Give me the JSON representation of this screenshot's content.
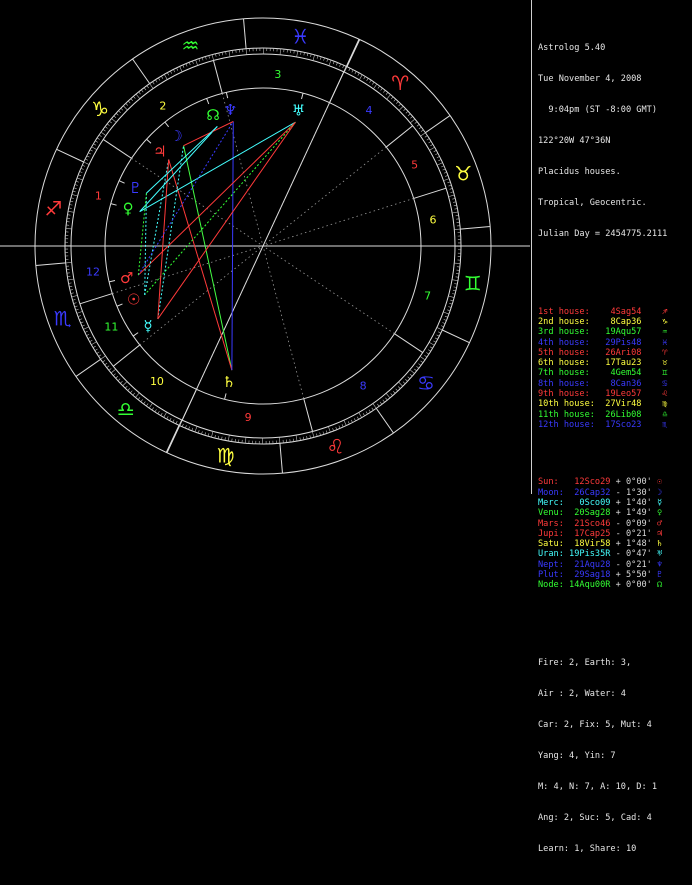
{
  "header": [
    "Astrolog 5.40",
    "Tue November 4, 2008",
    "  9:04pm (ST -8:00 GMT)",
    "122°20W 47°36N",
    "Placidus houses.",
    "Tropical, Geocentric.",
    "Julian Day = 2454775.2111"
  ],
  "houses": [
    {
      "label": "1st house:",
      "value": "4Sag54",
      "glyph": "♐",
      "color": "#ff3a3a"
    },
    {
      "label": "2nd house:",
      "value": "8Cap36",
      "glyph": "♑",
      "color": "#ffff40"
    },
    {
      "label": "3rd house:",
      "value": "19Aqu57",
      "glyph": "♒",
      "color": "#33ff33"
    },
    {
      "label": "4th house:",
      "value": "29Pis48",
      "glyph": "♓",
      "color": "#3a3aff"
    },
    {
      "label": "5th house:",
      "value": "26Ari08",
      "glyph": "♈",
      "color": "#ff3a3a"
    },
    {
      "label": "6th house:",
      "value": "17Tau23",
      "glyph": "♉",
      "color": "#ffff40"
    },
    {
      "label": "7th house:",
      "value": "4Gem54",
      "glyph": "♊",
      "color": "#33ff33"
    },
    {
      "label": "8th house:",
      "value": "8Can36",
      "glyph": "♋",
      "color": "#3a3aff"
    },
    {
      "label": "9th house:",
      "value": "19Leo57",
      "glyph": "♌",
      "color": "#ff3a3a"
    },
    {
      "label": "10th house:",
      "value": "27Vir48",
      "glyph": "♍",
      "color": "#ffff40"
    },
    {
      "label": "11th house:",
      "value": "26Lib08",
      "glyph": "♎",
      "color": "#33ff33"
    },
    {
      "label": "12th house:",
      "value": "17Sco23",
      "glyph": "♏",
      "color": "#3a3aff"
    }
  ],
  "planets": [
    {
      "name": "Sun:",
      "pos": "12Sco29",
      "speed": "+ 0°00'",
      "glyph": "☉",
      "color": "#ff3a3a"
    },
    {
      "name": "Moon:",
      "pos": "26Cap32",
      "speed": "- 1°30'",
      "glyph": "☽",
      "color": "#3a3aff"
    },
    {
      "name": "Merc:",
      "pos": "0Sco09",
      "speed": "+ 1°40'",
      "glyph": "☿",
      "color": "#44ffff"
    },
    {
      "name": "Venu:",
      "pos": "20Sag28",
      "speed": "+ 1°49'",
      "glyph": "♀",
      "color": "#33ff33"
    },
    {
      "name": "Mars:",
      "pos": "21Sco46",
      "speed": "- 0°09'",
      "glyph": "♂",
      "color": "#ff3a3a"
    },
    {
      "name": "Jupi:",
      "pos": "17Cap25",
      "speed": "- 0°21'",
      "glyph": "♃",
      "color": "#ff3a3a"
    },
    {
      "name": "Satu:",
      "pos": "18Vir58",
      "speed": "+ 1°48'",
      "glyph": "♄",
      "color": "#ffff40"
    },
    {
      "name": "Uran:",
      "pos": "19Pis35R",
      "speed": "- 0°47'",
      "glyph": "♅",
      "color": "#44ffff"
    },
    {
      "name": "Nept:",
      "pos": "21Aqu28",
      "speed": "- 0°21'",
      "glyph": "♆",
      "color": "#3a3aff"
    },
    {
      "name": "Plut:",
      "pos": "29Sag18",
      "speed": "+ 5°50'",
      "glyph": "♇",
      "color": "#3a3aff"
    },
    {
      "name": "Node:",
      "pos": "14Aqu00R",
      "speed": "+ 0°00'",
      "glyph": "☊",
      "color": "#33ff33"
    }
  ],
  "summary": [
    "Fire: 2, Earth: 3,",
    "Air : 2, Water: 4",
    "Car: 2, Fix: 5, Mut: 4",
    "Yang: 4, Yin: 7",
    "M: 4, N: 7, A: 10, D: 1",
    "Ang: 2, Suc: 5, Cad: 4",
    "Learn: 1, Share: 10"
  ],
  "wheel": {
    "signs": [
      {
        "name": "Aries",
        "glyph": "♈",
        "color": "#ff3a3a"
      },
      {
        "name": "Taurus",
        "glyph": "♉",
        "color": "#ffff40"
      },
      {
        "name": "Gemini",
        "glyph": "♊",
        "color": "#33ff33"
      },
      {
        "name": "Cancer",
        "glyph": "♋",
        "color": "#3a3aff"
      },
      {
        "name": "Leo",
        "glyph": "♌",
        "color": "#ff3a3a"
      },
      {
        "name": "Virgo",
        "glyph": "♍",
        "color": "#ffff40"
      },
      {
        "name": "Libra",
        "glyph": "♎",
        "color": "#33ff33"
      },
      {
        "name": "Scorpio",
        "glyph": "♏",
        "color": "#3a3aff"
      },
      {
        "name": "Sagittarius",
        "glyph": "♐",
        "color": "#ff3a3a"
      },
      {
        "name": "Capricorn",
        "glyph": "♑",
        "color": "#ffff40"
      },
      {
        "name": "Aquarius",
        "glyph": "♒",
        "color": "#33ff33"
      },
      {
        "name": "Pisces",
        "glyph": "♓",
        "color": "#3a3aff"
      }
    ],
    "house_numbers": [
      "1",
      "2",
      "3",
      "4",
      "5",
      "6",
      "7",
      "8",
      "9",
      "10",
      "11",
      "12"
    ],
    "house_number_colors": [
      "#ff3a3a",
      "#ffff40",
      "#33ff33",
      "#3a3aff",
      "#ff3a3a",
      "#ffff40",
      "#33ff33",
      "#3a3aff",
      "#ff3a3a",
      "#ffff40",
      "#33ff33",
      "#3a3aff"
    ],
    "ascendant_longitude": 244.9,
    "house_cusps": [
      244.9,
      278.6,
      319.95,
      359.8,
      26.13,
      47.38,
      64.9,
      98.6,
      139.95,
      179.8,
      206.13,
      227.38
    ],
    "planet_longitudes": [
      222.48,
      296.53,
      210.15,
      260.47,
      231.77,
      287.42,
      168.97,
      349.58,
      321.47,
      269.3,
      314.0
    ],
    "aspects": [
      {
        "from": 6,
        "to": 1,
        "color": "#44ff44",
        "style": "solid"
      },
      {
        "from": 6,
        "to": 5,
        "color": "#ff3a3a",
        "style": "solid"
      },
      {
        "from": 6,
        "to": 8,
        "color": "#3a3aff",
        "style": "solid"
      },
      {
        "from": 7,
        "to": 3,
        "color": "#44ffff",
        "style": "solid"
      },
      {
        "from": 7,
        "to": 4,
        "color": "#ff3a3a",
        "style": "solid"
      },
      {
        "from": 7,
        "to": 0,
        "color": "#33ff33",
        "style": "dotted"
      },
      {
        "from": 7,
        "to": 2,
        "color": "#ff3a3a",
        "style": "solid"
      },
      {
        "from": 0,
        "to": 9,
        "color": "#44ffff",
        "style": "dotted"
      },
      {
        "from": 0,
        "to": 5,
        "color": "#44ffff",
        "style": "dotted"
      },
      {
        "from": 2,
        "to": 1,
        "color": "#44ffff",
        "style": "dotted"
      },
      {
        "from": 2,
        "to": 5,
        "color": "#ff3a3a",
        "style": "solid"
      },
      {
        "from": 3,
        "to": 10,
        "color": "#44ffff",
        "style": "solid"
      },
      {
        "from": 4,
        "to": 8,
        "color": "#3a3aff",
        "style": "dotted"
      },
      {
        "from": 4,
        "to": 9,
        "color": "#33ff33",
        "style": "dotted"
      },
      {
        "from": 1,
        "to": 8,
        "color": "#ff3a3a",
        "style": "solid"
      },
      {
        "from": 9,
        "to": 10,
        "color": "#44ffff",
        "style": "solid"
      }
    ]
  }
}
